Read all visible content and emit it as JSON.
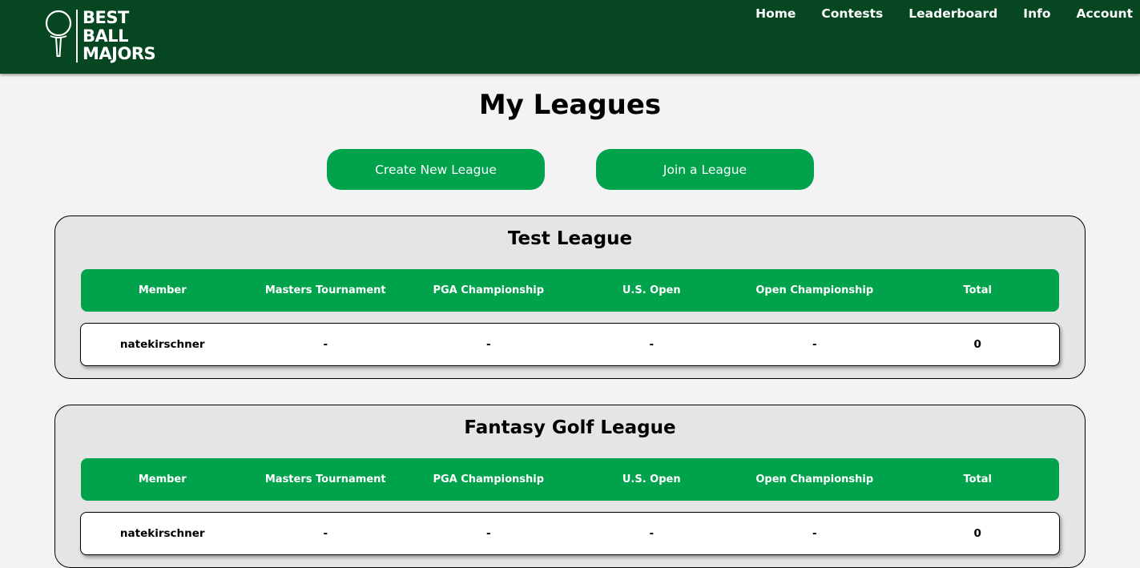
{
  "brand": {
    "logo_line1": "BEST",
    "logo_line2": "BALL",
    "logo_line3": "MAJORS",
    "logo_icon": "golf-ball-on-tee-icon"
  },
  "nav": {
    "items": [
      {
        "label": "Home"
      },
      {
        "label": "Contests"
      },
      {
        "label": "Leaderboard"
      },
      {
        "label": "Info"
      },
      {
        "label": "Account"
      }
    ]
  },
  "page": {
    "title": "My Leagues",
    "create_button": "Create New League",
    "join_button": "Join a League"
  },
  "columns": [
    "Member",
    "Masters Tournament",
    "PGA Championship",
    "U.S. Open",
    "Open Championship",
    "Total"
  ],
  "leagues": [
    {
      "name": "Test League",
      "rows": [
        {
          "member": "natekirschner",
          "masters": "-",
          "pga": "-",
          "us_open": "-",
          "open": "-",
          "total": "0"
        }
      ]
    },
    {
      "name": "Fantasy Golf League",
      "rows": [
        {
          "member": "natekirschner",
          "masters": "-",
          "pga": "-",
          "us_open": "-",
          "open": "-",
          "total": "0"
        }
      ]
    }
  ],
  "colors": {
    "header_bg": "#064722",
    "accent_green": "#00a24c",
    "page_bg": "#f3f3f3",
    "card_bg": "#e5e5e5"
  }
}
